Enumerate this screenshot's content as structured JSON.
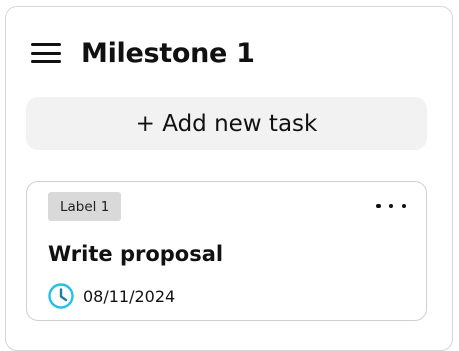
{
  "milestone": {
    "title": "Milestone 1"
  },
  "actions": {
    "add_task_label": "+ Add new task"
  },
  "card": {
    "label": "Label 1",
    "title": "Write proposal",
    "due_date": "08/11/2024",
    "date_icon": "clock-icon",
    "menu_icon": "more-icon"
  },
  "colors": {
    "clock_accent": "#22c1e6",
    "add_button_bg": "#f2f2f2",
    "label_bg": "#d9d9d9"
  }
}
